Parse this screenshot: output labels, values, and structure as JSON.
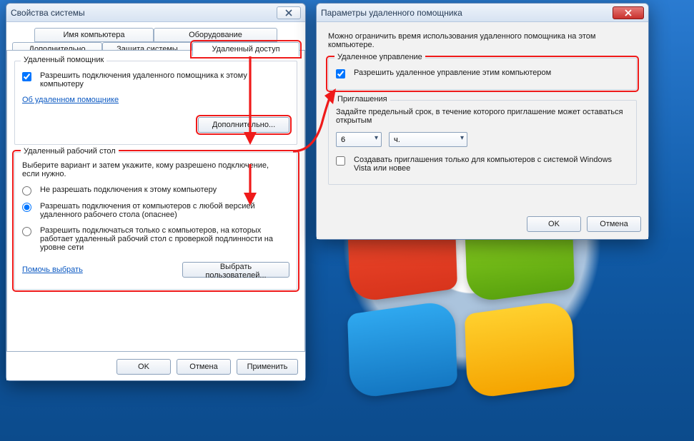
{
  "sysprops": {
    "title": "Свойства системы",
    "tabs": {
      "computer_name": "Имя компьютера",
      "hardware": "Оборудование",
      "advanced": "Дополнительно",
      "system_protection": "Защита системы",
      "remote": "Удаленный доступ"
    },
    "remote_assist": {
      "group": "Удаленный помощник",
      "allow_label": "Разрешить подключения удаленного помощника к этому компьютеру",
      "about_link": "Об удаленном помощнике",
      "advanced_btn": "Дополнительно..."
    },
    "rdp": {
      "group": "Удаленный рабочий стол",
      "instruction": "Выберите вариант и затем укажите, кому разрешено подключение, если нужно.",
      "opt_none": "Не разрешать подключения к этому компьютеру",
      "opt_any": "Разрешать подключения от компьютеров с любой версией удаленного рабочего стола (опаснее)",
      "opt_nla": "Разрешить подключаться только с компьютеров, на которых работает удаленный рабочий стол с проверкой подлинности на уровне сети",
      "help_link": "Помочь выбрать",
      "select_users_btn": "Выбрать пользователей..."
    },
    "buttons": {
      "ok": "OK",
      "cancel": "Отмена",
      "apply": "Применить"
    }
  },
  "rahelper": {
    "title": "Параметры удаленного помощника",
    "intro": "Можно ограничить время использования удаленного помощника на этом компьютере.",
    "control": {
      "group": "Удаленное управление",
      "allow_label": "Разрешить удаленное управление этим компьютером"
    },
    "invitations": {
      "group": "Приглашения",
      "instruction": "Задайте предельный срок, в течение которого приглашение может оставаться открытым",
      "value": "6",
      "unit": "ч.",
      "vista_label": "Создавать приглашения только для компьютеров с системой Windows Vista или новее"
    },
    "buttons": {
      "ok": "OK",
      "cancel": "Отмена"
    }
  }
}
